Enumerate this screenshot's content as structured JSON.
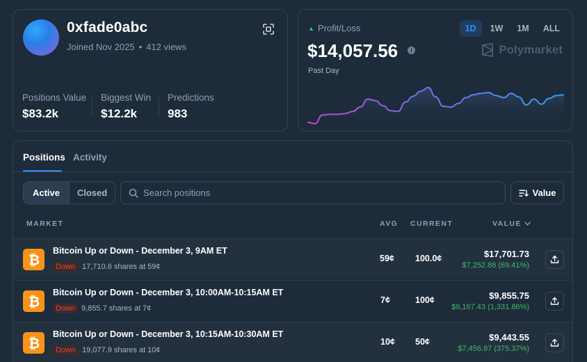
{
  "profile": {
    "username": "0xfade0abc",
    "joined": "Joined Nov 2025",
    "views": "412 views",
    "stats": [
      {
        "label": "Positions Value",
        "value": "$83.2k"
      },
      {
        "label": "Biggest Win",
        "value": "$12.2k"
      },
      {
        "label": "Predictions",
        "value": "983"
      }
    ]
  },
  "pnl": {
    "label": "Profit/Loss",
    "value": "$14,057.56",
    "period": "Past Day",
    "brand": "Polymarket",
    "timeframes": [
      "1D",
      "1W",
      "1M",
      "ALL"
    ],
    "active_timeframe": "1D",
    "spark_values": [
      12,
      10,
      22,
      23,
      23,
      24,
      27,
      33,
      44,
      42,
      35,
      28,
      27,
      40,
      48,
      55,
      60,
      47,
      34,
      33,
      38,
      46,
      50,
      52,
      53,
      49,
      46,
      52,
      47,
      36,
      44,
      37,
      45,
      49,
      50
    ],
    "colors": {
      "up": "#3dba68",
      "line_start": "#c04ad8",
      "line_end": "#33a0f0"
    }
  },
  "tabs": {
    "positions": "Positions",
    "activity": "Activity"
  },
  "filters": {
    "active": "Active",
    "closed": "Closed",
    "search_placeholder": "Search positions",
    "sort_label": "Value"
  },
  "columns": {
    "market": "MARKET",
    "avg": "AVG",
    "current": "CURRENT",
    "value": "VALUE"
  },
  "rows": [
    {
      "title": "Bitcoin Up or Down - December 3, 9AM ET",
      "outcome": "Down",
      "shares": "17,710.6 shares at 59¢",
      "avg": "59¢",
      "current": "100.0¢",
      "value": "$17,701.73",
      "pnl": "$7,252.88 (69.41%)"
    },
    {
      "title": "Bitcoin Up or Down - December 3, 10:00AM-10:15AM ET",
      "outcome": "Down",
      "shares": "9,855.7 shares at 7¢",
      "avg": "7¢",
      "current": "100¢",
      "value": "$9,855.75",
      "pnl": "$9,167.43 (1,331.86%)"
    },
    {
      "title": "Bitcoin Up or Down - December 3, 10:15AM-10:30AM ET",
      "outcome": "Down",
      "shares": "19,077.9 shares at 10¢",
      "avg": "10¢",
      "current": "50¢",
      "value": "$9,443.55",
      "pnl": "$7,456.97 (375.37%)"
    }
  ]
}
